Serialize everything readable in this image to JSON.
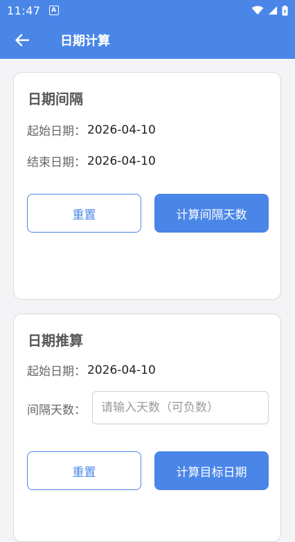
{
  "status_bar": {
    "time": "11:47",
    "notification_glyph": "A"
  },
  "app_bar": {
    "title": "日期计算"
  },
  "interval_card": {
    "title": "日期间隔",
    "start_label": "起始日期：",
    "start_value": "2026-04-10",
    "end_label": "结束日期：",
    "end_value": "2026-04-10",
    "reset_label": "重置",
    "calc_label": "计算间隔天数"
  },
  "offset_card": {
    "title": "日期推算",
    "start_label": "起始日期：",
    "start_value": "2026-04-10",
    "days_label": "间隔天数：",
    "days_placeholder": "请输入天数（可负数）",
    "reset_label": "重置",
    "calc_label": "计算目标日期"
  },
  "colors": {
    "primary": "#4a86e8",
    "background": "#f4f4f6"
  }
}
